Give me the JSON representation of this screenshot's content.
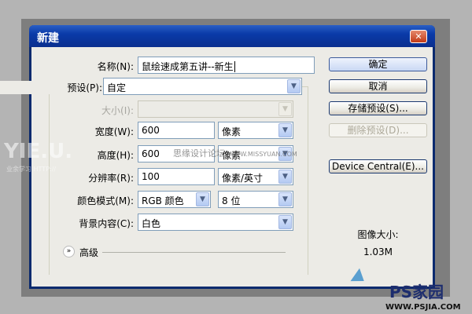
{
  "dialog": {
    "title": "新建",
    "close_label": "✕"
  },
  "form": {
    "name_label": "名称(N):",
    "name_value": "鼠绘速成第五讲--新生",
    "preset_label": "预设(P):",
    "preset_value": "自定",
    "size_label": "大小(I):",
    "size_value": "",
    "width_label": "宽度(W):",
    "width_value": "600",
    "width_unit": "像素",
    "height_label": "高度(H):",
    "height_value": "600",
    "height_unit": "像素",
    "resolution_label": "分辨率(R):",
    "resolution_value": "100",
    "resolution_unit": "像素/英寸",
    "color_mode_label": "颜色模式(M):",
    "color_mode_value": "RGB 颜色",
    "bit_depth_value": "8 位",
    "background_label": "背景内容(C):",
    "background_value": "白色",
    "advanced_label": "高级"
  },
  "buttons": {
    "ok": "确定",
    "cancel": "取消",
    "save_preset": "存储预设(S)...",
    "delete_preset": "删除预设(D)...",
    "device_central": "Device Central(E)..."
  },
  "image_size": {
    "label": "图像大小:",
    "value": "1.03M"
  },
  "watermarks": {
    "left": "YIE.U.",
    "left_sub": "业余学习 HTTP://",
    "center": "思缘设计论坛",
    "center_url": "WWW.MISSYUAN.COM",
    "logo": "PS家园",
    "logo_url": "WWW.PSJIA.COM"
  }
}
